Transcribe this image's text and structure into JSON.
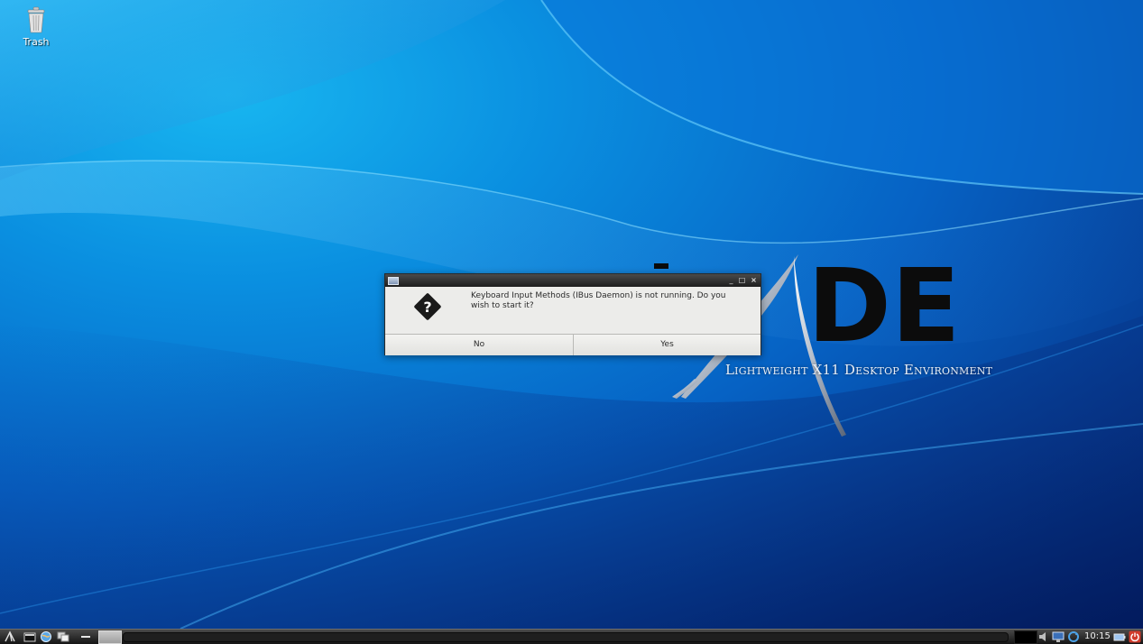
{
  "desktop": {
    "icons": [
      {
        "label": "Trash",
        "icon": "trash-icon"
      }
    ],
    "logo": {
      "text": "DE",
      "tagline": "Lightweight X11 Desktop Environment"
    }
  },
  "dialog": {
    "icon": "question-icon",
    "message": "Keyboard Input Methods (IBus Daemon) is not running. Do you wish to start it?",
    "window_controls": {
      "minimize": "_",
      "maximize": "□",
      "close": "×"
    },
    "buttons": {
      "no": "No",
      "yes": "Yes"
    }
  },
  "taskbar": {
    "launchers": [
      "menu-icon",
      "terminal-icon",
      "browser-icon",
      "window-switch-icon",
      "minimize-all-icon"
    ],
    "tray": [
      "volume-icon",
      "network-icon",
      "update-icon",
      "battery-icon",
      "power-icon"
    ],
    "clock": "10:15",
    "colors": {
      "accent": "#0a8fe0",
      "dark": "#1d1d1d"
    }
  }
}
